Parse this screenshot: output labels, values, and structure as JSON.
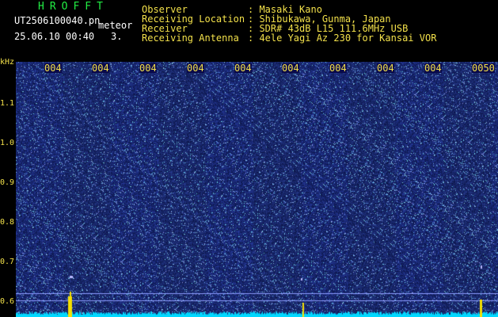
{
  "header": {
    "logo": "HROFFT",
    "filename": "UT2506100040.pn",
    "type_label": "meteor",
    "datetime": "25.06.10 00:40",
    "count": "3."
  },
  "info": {
    "observer_label": "Observer",
    "observer_value": ": Masaki Kano",
    "location_label": "Receiving Location",
    "location_value": ": Shibukawa, Gunma, Japan",
    "receiver_label": "Receiver",
    "receiver_value": ": SDR# 43dB L15 111.6MHz USB",
    "antenna_label": "Receiving Antenna",
    "antenna_value": ": 4ele Yagi Az 230 for Kansai VOR"
  },
  "axis": {
    "y_unit": "kHz",
    "y_ticks": [
      "1.1",
      "1.0",
      "0.9",
      "0.8",
      "0.7",
      "0.6"
    ],
    "x_ticks": [
      "004",
      "004",
      "004",
      "004",
      "004",
      "004",
      "004",
      "004",
      "004",
      "0050"
    ]
  },
  "colors": {
    "background": "#0a0a52",
    "noise": "#3a4ad8",
    "signal": "#f5e000",
    "baseline": "#00d8ff",
    "text_yellow": "#f2e04a",
    "text_green": "#22ee44"
  }
}
